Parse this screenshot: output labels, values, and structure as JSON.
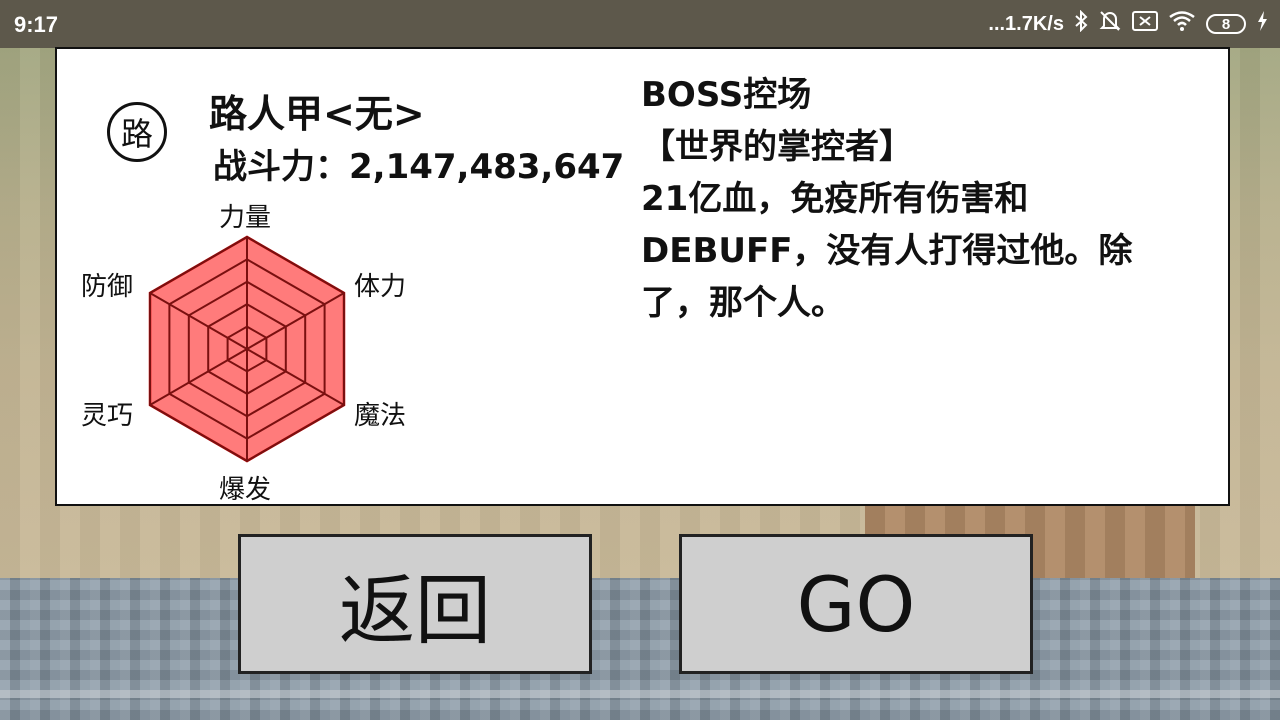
{
  "status_bar": {
    "time": "9:17",
    "network_speed": "...1.7K/s",
    "battery_level": "8",
    "icons": [
      "bluetooth-icon",
      "mute-icon",
      "sim-icon",
      "wifi-icon",
      "battery-icon",
      "charging-icon"
    ]
  },
  "character": {
    "avatar_char": "路",
    "name": "路人甲<无>",
    "power_label": "战斗力：",
    "power_value": "2,147,483,647"
  },
  "stats": {
    "labels": [
      "力量",
      "体力",
      "魔法",
      "爆发",
      "灵巧",
      "防御"
    ],
    "values": [
      1,
      1,
      1,
      1,
      1,
      1
    ],
    "fill_color": "#ff7b7b",
    "line_color": "#cc0000"
  },
  "description": {
    "lines": [
      "BOSS控场",
      "【世界的掌控者】",
      "21亿血，免疫所有伤害和",
      "DEBUFF，没有人打得过他。除",
      "了，那个人。"
    ]
  },
  "buttons": {
    "back": "返回",
    "go": "GO"
  }
}
